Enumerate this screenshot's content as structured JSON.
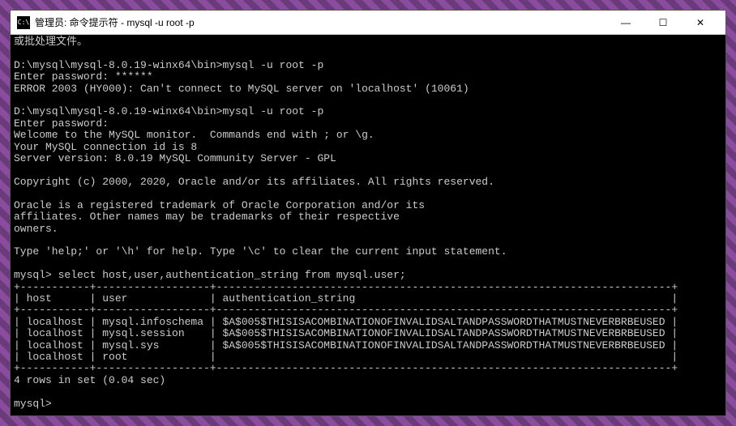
{
  "window": {
    "title": "管理员: 命令提示符 - mysql  -u root -p",
    "icon_label": "C:\\",
    "controls": {
      "minimize": "—",
      "maximize": "☐",
      "close": "✕"
    }
  },
  "terminal": {
    "lines": [
      "或批处理文件。",
      "",
      "D:\\mysql\\mysql-8.0.19-winx64\\bin>mysql -u root -p",
      "Enter password: ******",
      "ERROR 2003 (HY000): Can't connect to MySQL server on 'localhost' (10061)",
      "",
      "D:\\mysql\\mysql-8.0.19-winx64\\bin>mysql -u root -p",
      "Enter password:",
      "Welcome to the MySQL monitor.  Commands end with ; or \\g.",
      "Your MySQL connection id is 8",
      "Server version: 8.0.19 MySQL Community Server - GPL",
      "",
      "Copyright (c) 2000, 2020, Oracle and/or its affiliates. All rights reserved.",
      "",
      "Oracle is a registered trademark of Oracle Corporation and/or its",
      "affiliates. Other names may be trademarks of their respective",
      "owners.",
      "",
      "Type 'help;' or '\\h' for help. Type '\\c' to clear the current input statement.",
      "",
      "mysql> select host,user,authentication_string from mysql.user;",
      "+-----------+------------------+------------------------------------------------------------------------+",
      "| host      | user             | authentication_string                                                  |",
      "+-----------+------------------+------------------------------------------------------------------------+",
      "| localhost | mysql.infoschema | $A$005$THISISACOMBINATIONOFINVALIDSALTANDPASSWORDTHATMUSTNEVERBRBEUSED |",
      "| localhost | mysql.session    | $A$005$THISISACOMBINATIONOFINVALIDSALTANDPASSWORDTHATMUSTNEVERBRBEUSED |",
      "| localhost | mysql.sys        | $A$005$THISISACOMBINATIONOFINVALIDSALTANDPASSWORDTHATMUSTNEVERBRBEUSED |",
      "| localhost | root             |                                                                        |",
      "+-----------+------------------+------------------------------------------------------------------------+",
      "4 rows in set (0.04 sec)",
      "",
      "mysql>"
    ]
  },
  "query_result": {
    "columns": [
      "host",
      "user",
      "authentication_string"
    ],
    "rows": [
      {
        "host": "localhost",
        "user": "mysql.infoschema",
        "authentication_string": "$A$005$THISISACOMBINATIONOFINVALIDSALTANDPASSWORDTHATMUSTNEVERBRBEUSED"
      },
      {
        "host": "localhost",
        "user": "mysql.session",
        "authentication_string": "$A$005$THISISACOMBINATIONOFINVALIDSALTANDPASSWORDTHATMUSTNEVERBRBEUSED"
      },
      {
        "host": "localhost",
        "user": "mysql.sys",
        "authentication_string": "$A$005$THISISACOMBINATIONOFINVALIDSALTANDPASSWORDTHATMUSTNEVERBRBEUSED"
      },
      {
        "host": "localhost",
        "user": "root",
        "authentication_string": ""
      }
    ],
    "row_count": 4,
    "elapsed_sec": 0.04
  }
}
